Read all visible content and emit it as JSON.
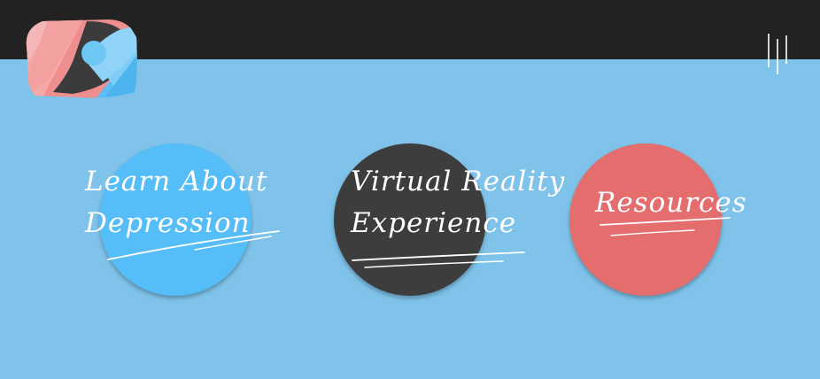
{
  "header": {
    "logo_icon": "brain-logo-icon",
    "menu_icon": "menu-lines-icon",
    "bar_color": "#222222"
  },
  "nav": {
    "learn": {
      "line1": "Learn About",
      "line2": "Depression",
      "color": "#55bdf8"
    },
    "vr": {
      "line1": "Virtual Reality",
      "line2": "Experience",
      "color": "#3d3d3d"
    },
    "resources": {
      "line1": "Resources",
      "color": "#e46d6d"
    }
  },
  "background_color": "#7fc3ea"
}
